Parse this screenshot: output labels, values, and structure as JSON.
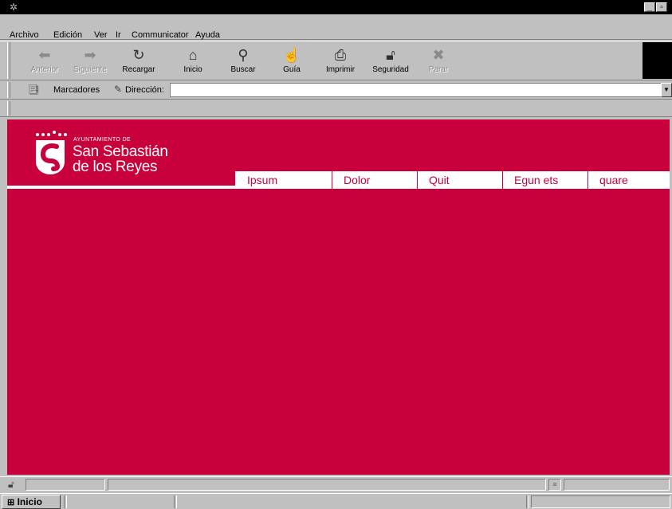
{
  "menu": {
    "items": [
      {
        "label": "Archivo"
      },
      {
        "label": "Edición"
      },
      {
        "label": "Ver"
      },
      {
        "label": "Ir"
      },
      {
        "label": "Communicator"
      },
      {
        "label": "Ayuda"
      }
    ]
  },
  "toolbar": {
    "buttons": [
      {
        "label": "Anterior",
        "icon": "back-arrow-icon",
        "enabled": false
      },
      {
        "label": "Siguiente",
        "icon": "forward-arrow-icon",
        "enabled": false
      },
      {
        "label": "Recargar",
        "icon": "reload-icon",
        "enabled": true
      },
      {
        "label": "Inicio",
        "icon": "home-icon",
        "enabled": true
      },
      {
        "label": "Buscar",
        "icon": "search-icon",
        "enabled": true
      },
      {
        "label": "Guía",
        "icon": "guide-icon",
        "enabled": true
      },
      {
        "label": "Imprimir",
        "icon": "printer-icon",
        "enabled": true
      },
      {
        "label": "Seguridad",
        "icon": "lock-icon",
        "enabled": true
      },
      {
        "label": "Parar",
        "icon": "stop-icon",
        "enabled": false
      }
    ]
  },
  "location": {
    "bookmarks_label": "Marcadores",
    "address_label": "Dirección:",
    "url_value": ""
  },
  "page": {
    "brand_color": "#c8003c",
    "logo": {
      "small": "AYUNTAMIENTO DE",
      "line1": "San Sebastián",
      "line2": "de los Reyes"
    },
    "nav": [
      {
        "label": "Ipsum"
      },
      {
        "label": "Dolor"
      },
      {
        "label": "Quit"
      },
      {
        "label": "Egun ets"
      },
      {
        "label": "quare"
      }
    ]
  },
  "taskbar": {
    "start_label": "Inicio"
  }
}
